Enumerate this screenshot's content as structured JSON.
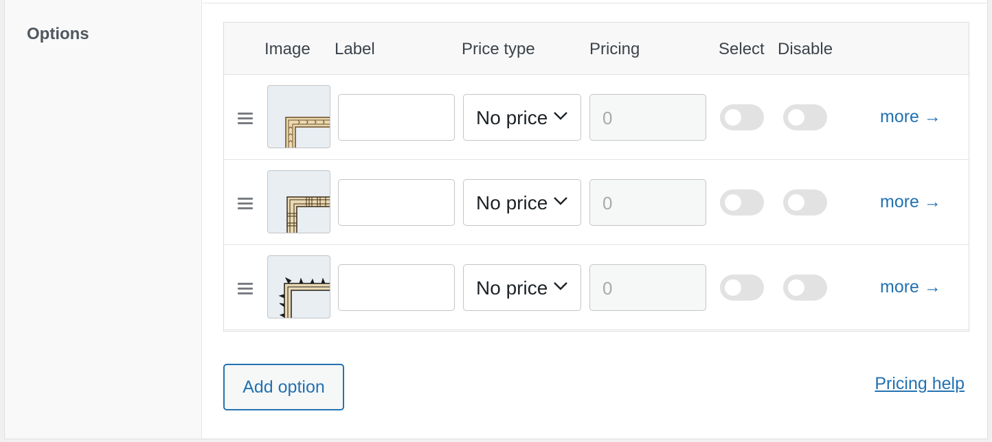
{
  "section": {
    "title": "Options"
  },
  "table": {
    "headers": {
      "image": "Image",
      "label": "Label",
      "price_type": "Price type",
      "pricing": "Pricing",
      "select": "Select",
      "disable": "Disable"
    },
    "rows": [
      {
        "image_icon": "ornate-frame-corner-thumbnail",
        "label_value": "",
        "price_type": "No price",
        "pricing_placeholder": "0",
        "select_on": false,
        "disable_on": false,
        "more_label": "more →"
      },
      {
        "image_icon": "ladder-frame-corner-thumbnail",
        "label_value": "",
        "price_type": "No price",
        "pricing_placeholder": "0",
        "select_on": false,
        "disable_on": false,
        "more_label": "more →"
      },
      {
        "image_icon": "thorny-frame-corner-thumbnail",
        "label_value": "",
        "price_type": "No price",
        "pricing_placeholder": "0",
        "select_on": false,
        "disable_on": false,
        "more_label": "more →"
      }
    ]
  },
  "actions": {
    "add_option": "Add option",
    "pricing_help": "Pricing help"
  },
  "colors": {
    "accent": "#2271b1",
    "label_column_bg": "#f9f9f9",
    "toggle_off": "#e2e2e3"
  }
}
